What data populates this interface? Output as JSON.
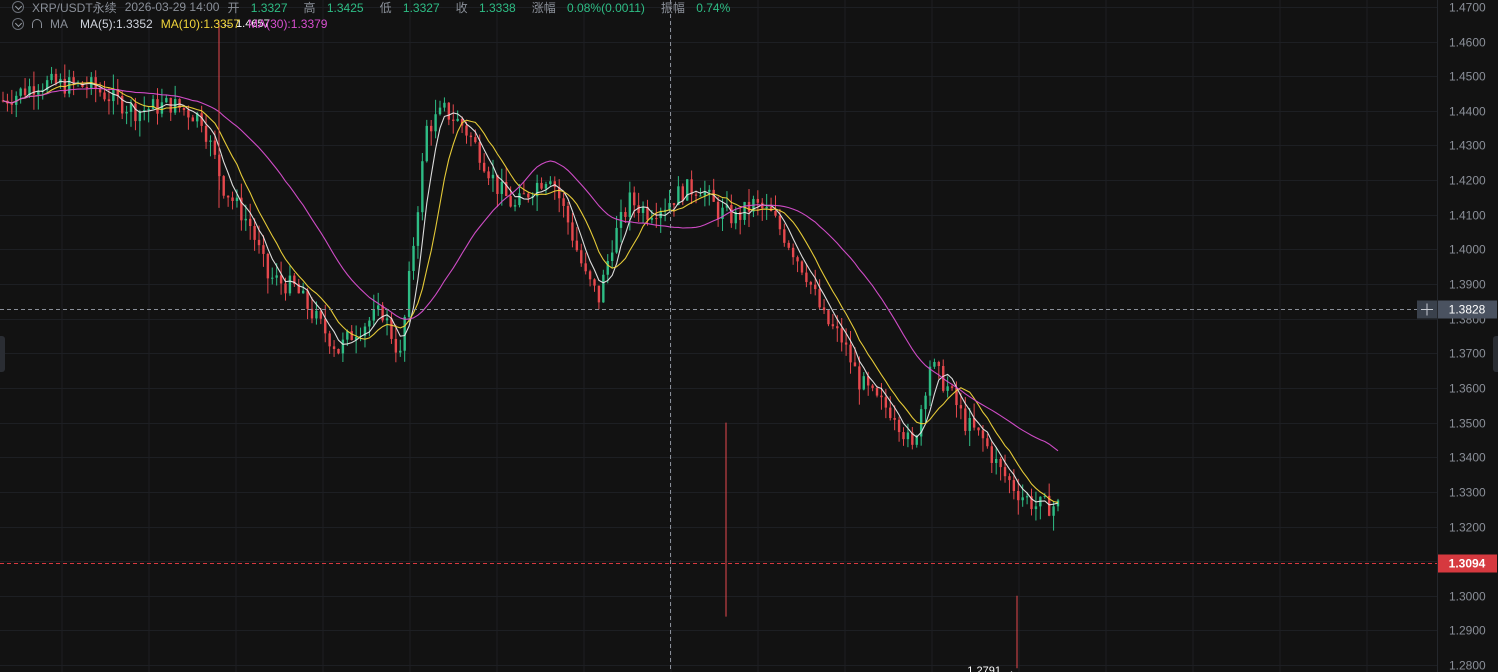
{
  "header": {
    "symbol": "XRP/USDT永续",
    "datetime": "2026-03-29 14:00",
    "open_label": "开",
    "open_value": "1.3327",
    "high_label": "高",
    "high_value": "1.3425",
    "low_label": "低",
    "low_value": "1.3327",
    "close_label": "收",
    "close_value": "1.3338",
    "change_label": "涨幅",
    "change_value": "0.08%(0.0011)",
    "amplitude_label": "振幅",
    "amplitude_value": "0.74%"
  },
  "indicators": {
    "name": "MA",
    "ma5": "MA(5):1.3352",
    "ma10": "MA(10):1.3357",
    "ma30": "MA(30):1.3379"
  },
  "colors": {
    "background": "#121212",
    "up": "#2ebd85",
    "down": "#e5484d",
    "ma5": "#e8e8e8",
    "ma10": "#f0d43a",
    "ma30": "#d94fd0",
    "last_price_bg": "#d6393f",
    "crosshair_label_bg": "#4a5260"
  },
  "chart_data": {
    "type": "candlestick",
    "ylim": [
      1.278,
      1.472
    ],
    "y_ticks": [
      "1.4700",
      "1.4600",
      "1.4500",
      "1.4400",
      "1.4300",
      "1.4200",
      "1.4100",
      "1.4000",
      "1.3900",
      "1.3800",
      "1.3700",
      "1.3600",
      "1.3500",
      "1.3400",
      "1.3300",
      "1.3200",
      "1.3100",
      "1.3000",
      "1.2900",
      "1.2800"
    ],
    "grid": true,
    "candle_count": 240,
    "high_marker": "1.4657",
    "low_marker": "1.2791",
    "crosshair_price": "1.3828",
    "last_price": "1.3094",
    "close_path": [
      [
        0,
        1.443
      ],
      [
        8,
        1.448
      ],
      [
        20,
        1.447
      ],
      [
        30,
        1.44
      ],
      [
        38,
        1.442
      ],
      [
        45,
        1.438
      ],
      [
        50,
        1.418
      ],
      [
        56,
        1.407
      ],
      [
        60,
        1.392
      ],
      [
        66,
        1.389
      ],
      [
        72,
        1.378
      ],
      [
        76,
        1.371
      ],
      [
        80,
        1.377
      ],
      [
        86,
        1.382
      ],
      [
        90,
        1.369
      ],
      [
        93,
        1.402
      ],
      [
        96,
        1.435
      ],
      [
        100,
        1.44
      ],
      [
        104,
        1.436
      ],
      [
        108,
        1.428
      ],
      [
        112,
        1.418
      ],
      [
        116,
        1.412
      ],
      [
        120,
        1.418
      ],
      [
        124,
        1.422
      ],
      [
        128,
        1.408
      ],
      [
        132,
        1.392
      ],
      [
        135,
        1.386
      ],
      [
        138,
        1.402
      ],
      [
        142,
        1.414
      ],
      [
        146,
        1.411
      ],
      [
        150,
        1.413
      ],
      [
        154,
        1.417
      ],
      [
        158,
        1.418
      ],
      [
        162,
        1.411
      ],
      [
        166,
        1.409
      ],
      [
        170,
        1.413
      ],
      [
        174,
        1.41
      ],
      [
        178,
        1.402
      ],
      [
        182,
        1.393
      ],
      [
        186,
        1.38
      ],
      [
        190,
        1.374
      ],
      [
        194,
        1.362
      ],
      [
        198,
        1.356
      ],
      [
        202,
        1.353
      ],
      [
        206,
        1.342
      ],
      [
        210,
        1.367
      ],
      [
        214,
        1.36
      ],
      [
        218,
        1.35
      ],
      [
        222,
        1.345
      ],
      [
        226,
        1.336
      ],
      [
        230,
        1.33
      ],
      [
        234,
        1.326
      ]
    ]
  }
}
